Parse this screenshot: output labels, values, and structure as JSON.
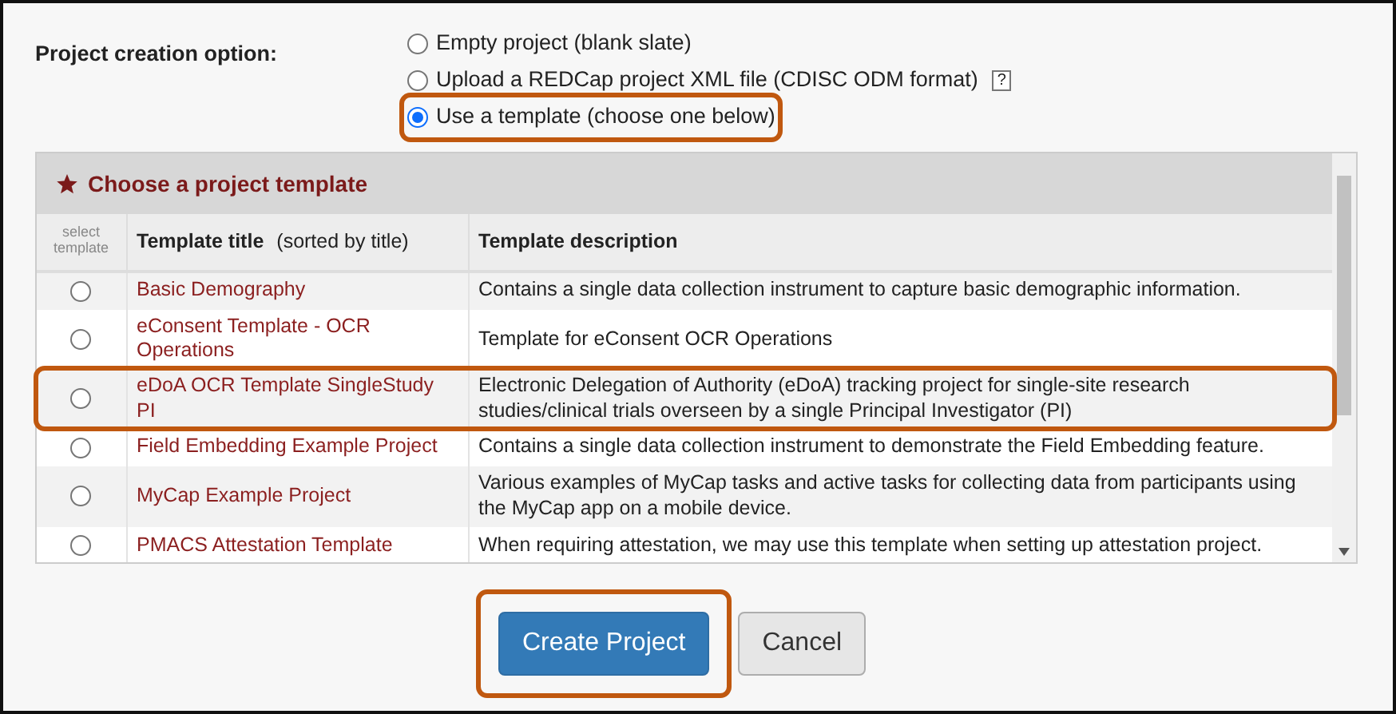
{
  "creation_option": {
    "label": "Project creation option:",
    "options": [
      {
        "label": "Empty project (blank slate)",
        "selected": false,
        "highlighted": false
      },
      {
        "label": "Upload a REDCap project XML file (CDISC ODM format)",
        "help": "?",
        "selected": false,
        "highlighted": false
      },
      {
        "label": "Use a template (choose one below)",
        "selected": true,
        "highlighted": true
      }
    ]
  },
  "template_panel": {
    "title": "Choose a project template",
    "columns": [
      {
        "label": "select template"
      },
      {
        "label": "Template title",
        "note": "(sorted by title)"
      },
      {
        "label": "Template description"
      }
    ],
    "rows": [
      {
        "title": "Basic Demography",
        "description": "Contains a single data collection instrument to capture basic demographic information.",
        "selected": false,
        "highlighted": false
      },
      {
        "title": "eConsent Template - OCR Operations",
        "description": "Template for eConsent OCR Operations",
        "selected": false,
        "highlighted": false
      },
      {
        "title": "eDoA OCR Template SingleStudy PI",
        "description": "Electronic Delegation of Authority (eDoA) tracking project for single-site research studies/clinical trials overseen by a single Principal Investigator (PI)",
        "selected": false,
        "highlighted": true
      },
      {
        "title": "Field Embedding Example Project",
        "description": "Contains a single data collection instrument to demonstrate the Field Embedding feature.",
        "selected": false,
        "highlighted": false
      },
      {
        "title": "MyCap Example Project",
        "description": "Various examples of MyCap tasks and active tasks for collecting data from participants using the MyCap app on a mobile device.",
        "selected": false,
        "highlighted": false
      },
      {
        "title": "PMACS Attestation Template",
        "description": "When requiring attestation, we may use this template when setting up attestation project.",
        "selected": false,
        "highlighted": false
      }
    ]
  },
  "buttons": [
    {
      "label": "Create Project",
      "kind": "primary",
      "highlighted": true
    },
    {
      "label": "Cancel",
      "kind": "secondary",
      "highlighted": false
    }
  ]
}
